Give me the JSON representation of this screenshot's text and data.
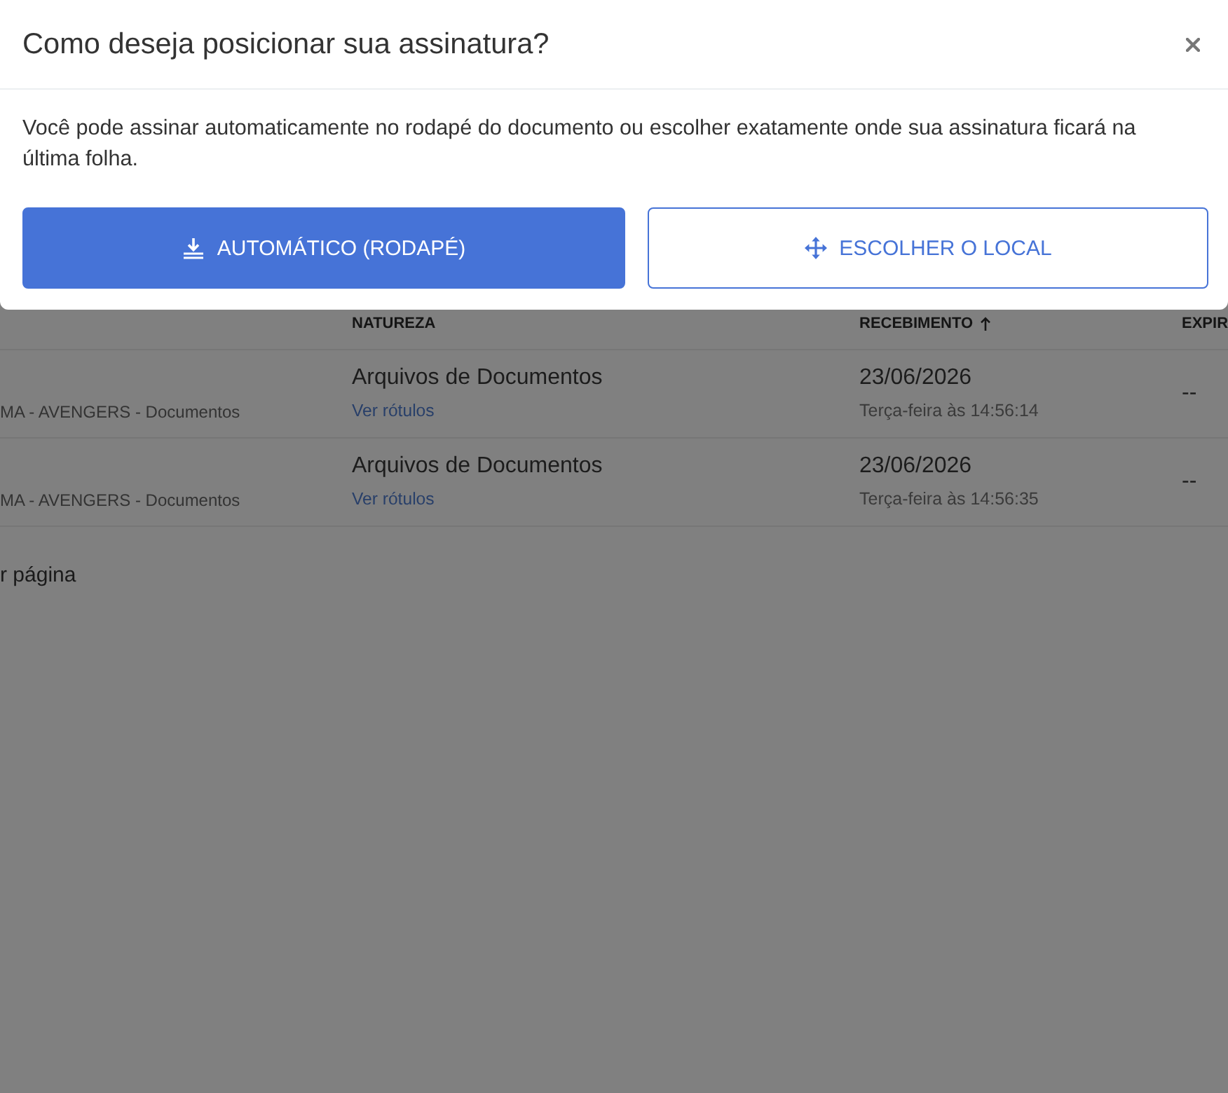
{
  "dialog": {
    "title": "Como deseja posicionar sua assinatura?",
    "message": "Você pode assinar automaticamente no rodapé do documento ou escolher exatamente onde sua assinatura ficará na última folha.",
    "buttons": [
      {
        "label": "AUTOMÁTICO (RODAPÉ)",
        "kind": "primary"
      },
      {
        "label": "ESCOLHER O LOCAL",
        "kind": "outline"
      }
    ]
  },
  "table": {
    "columns": [
      {
        "label": "NATUREZA",
        "sorted": false
      },
      {
        "label": "RECEBIMENTO",
        "sorted": true
      },
      {
        "label": "EXPIR",
        "sorted": false
      }
    ],
    "rows": [
      {
        "column_1": "MA - AVENGERS - Documentos",
        "natureza": "Arquivos de Documentos",
        "link": "Ver rótulos",
        "date": "23/06/2026",
        "time": "Terça-feira às 14:56:14",
        "expiry": "--"
      },
      {
        "column_1": "MA - AVENGERS - Documentos",
        "natureza": "Arquivos de Documentos",
        "link": "Ver rótulos",
        "date": "23/06/2026",
        "time": "Terça-feira às 14:56:35",
        "expiry": "--"
      }
    ]
  },
  "pagination": {
    "label": "r página"
  }
}
